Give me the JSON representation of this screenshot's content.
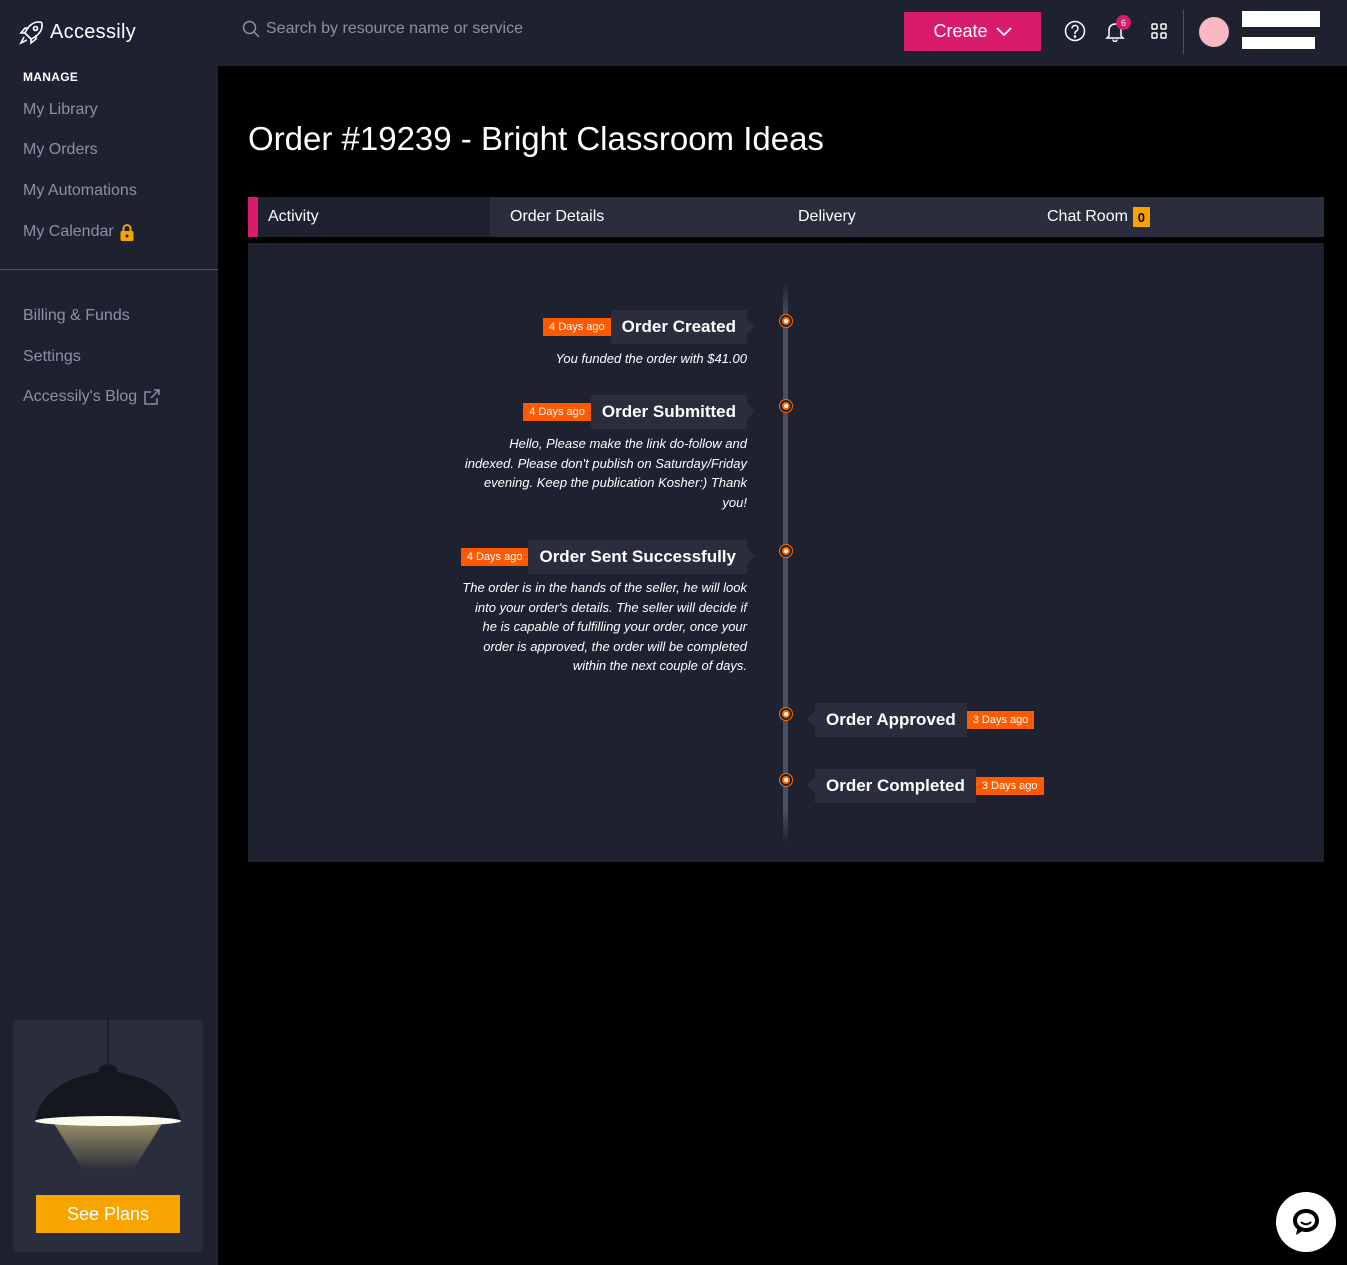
{
  "brand": {
    "name": "Accessily"
  },
  "sidebar": {
    "section_label": "MANAGE",
    "items": [
      {
        "label": "My Library"
      },
      {
        "label": "My Orders"
      },
      {
        "label": "My Automations"
      },
      {
        "label": "My Calendar",
        "icon": "lock-icon"
      },
      {
        "label": "Billing & Funds"
      },
      {
        "label": "Settings"
      },
      {
        "label": "Accessily's Blog",
        "icon": "external-link-icon"
      }
    ],
    "promo": {
      "button_label": "See Plans"
    }
  },
  "topbar": {
    "search_placeholder": "Search by resource name or service",
    "create_label": "Create",
    "notification_count": "6"
  },
  "page": {
    "title": "Order #19239 - Bright Classroom Ideas",
    "tabs": [
      {
        "label": "Activity"
      },
      {
        "label": "Order Details"
      },
      {
        "label": "Delivery"
      },
      {
        "label": "Chat Room",
        "badge": "0"
      }
    ]
  },
  "timeline": [
    {
      "title": "Order Created",
      "time": "4 Days ago",
      "description": "You funded the order with $41.00"
    },
    {
      "title": "Order Submitted",
      "time": "4 Days ago",
      "description": "Hello, Please make the link do-follow and indexed. Please don't publish on Saturday/Friday evening. Keep the publication Kosher:) Thank you!"
    },
    {
      "title": "Order Sent Successfully",
      "time": "4 Days ago",
      "description": "The order is in the hands of the seller, he will look into your order's details. The seller will decide if he is capable of fulfilling your order, once your order is approved, the order will be completed within the next couple of days."
    },
    {
      "title": "Order Approved",
      "time": "3 Days ago"
    },
    {
      "title": "Order Completed",
      "time": "3 Days ago"
    }
  ],
  "colors": {
    "accent": "#d81b6a",
    "timeline_accent": "#ff5a00",
    "cta": "#f7a400",
    "sidebar_bg": "#1e2230"
  }
}
